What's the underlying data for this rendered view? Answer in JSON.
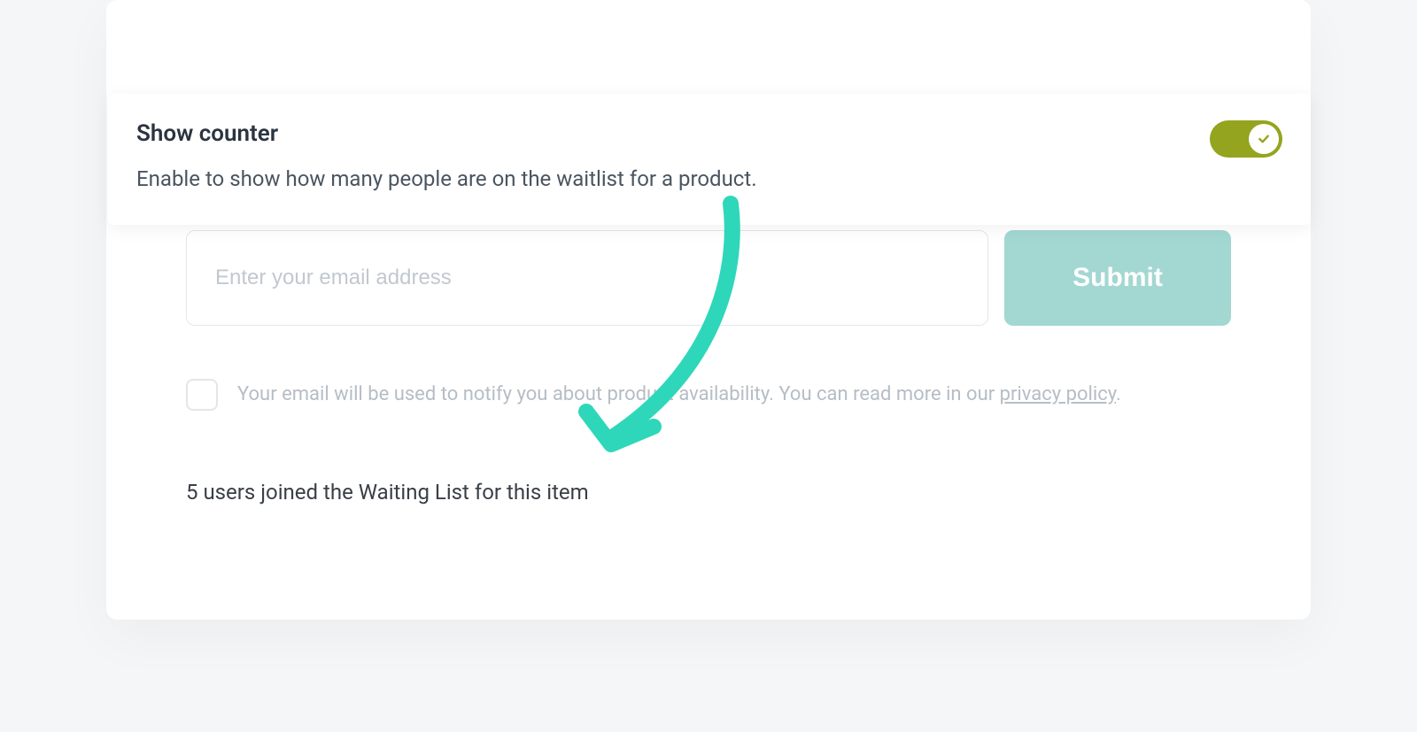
{
  "settings": {
    "title": "Show counter",
    "description": "Enable to show how many people are on the waitlist for a product.",
    "toggle_on": true
  },
  "form": {
    "email_placeholder": "Enter your email address",
    "submit_label": "Submit"
  },
  "consent": {
    "text_before": "Your email will be used to notify you about product availability. You can read more in our ",
    "link_label": "privacy policy",
    "text_after": "."
  },
  "counter": {
    "text": "5 users joined the Waiting List for this item"
  },
  "colors": {
    "accent_teal": "#a3d7d2",
    "arrow": "#2ed7b9",
    "toggle_active": "#95a41e"
  }
}
